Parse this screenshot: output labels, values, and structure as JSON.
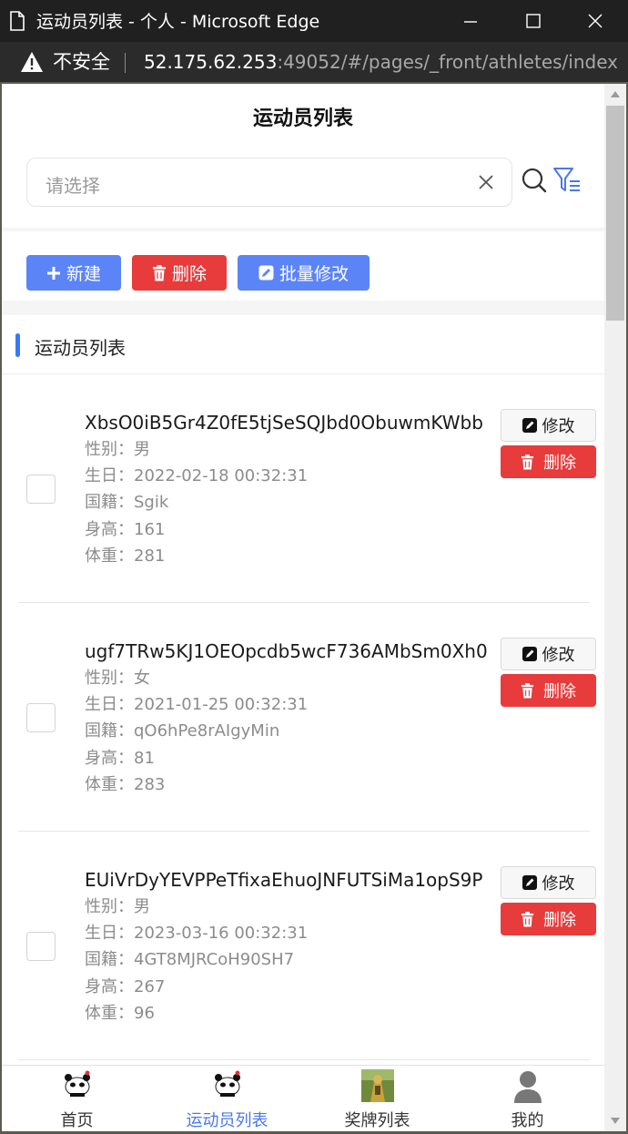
{
  "window": {
    "title": "运动员列表 - 个人 - Microsoft Edge",
    "security_label": "不安全",
    "url_host": "52.175.62.253",
    "url_rest": ":49052/#/pages/_front/athletes/index"
  },
  "page": {
    "title": "运动员列表",
    "search_placeholder": "请选择"
  },
  "toolbar": {
    "new_label": "新建",
    "delete_label": "删除",
    "batch_edit_label": "批量修改"
  },
  "list": {
    "section_label": "运动员列表",
    "edit_label": "修改",
    "delete_label": "删除",
    "items": [
      {
        "name": "XbsO0iB5Gr4Z0fE5tjSeSQJbd0ObuwmKWbb",
        "gender": "性别：男",
        "birthday": "生日：2022-02-18 00:32:31",
        "nationality": "国籍：Sgik",
        "height": "身高：161",
        "weight": "体重：281"
      },
      {
        "name": "ugf7TRw5KJ1OEOpcdb5wcF736AMbSm0Xh0",
        "gender": "性别：女",
        "birthday": "生日：2021-01-25 00:32:31",
        "nationality": "国籍：qO6hPe8rAIgyMin",
        "height": "身高：81",
        "weight": "体重：283"
      },
      {
        "name": "EUiVrDyYEVPPeTfixaEhuoJNFUTSiMa1opS9P",
        "gender": "性别：男",
        "birthday": "生日：2023-03-16 00:32:31",
        "nationality": "国籍：4GT8MJRCoH90SH7",
        "height": "身高：267",
        "weight": "体重：96"
      }
    ]
  },
  "tabbar": {
    "items": [
      {
        "label": "首页",
        "icon": "panda-icon"
      },
      {
        "label": "运动员列表",
        "icon": "panda-icon"
      },
      {
        "label": "奖牌列表",
        "icon": "photo-thumbnail"
      },
      {
        "label": "我的",
        "icon": "user-icon"
      }
    ],
    "active_index": 1,
    "active_color": "#4a78e8"
  },
  "colors": {
    "primary": "#5b84f7",
    "danger": "#e83b3b",
    "accent_bar": "#3a78f2"
  }
}
